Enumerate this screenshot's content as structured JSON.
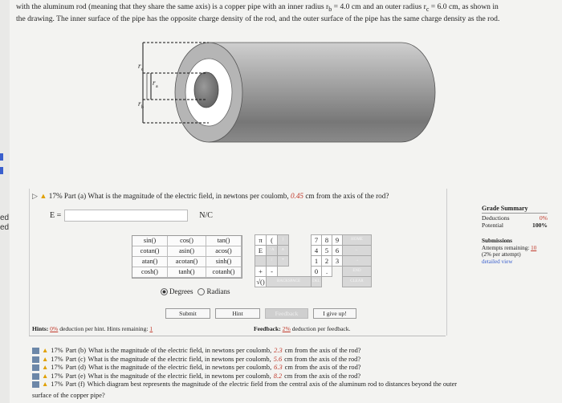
{
  "left_strip": {
    "marks": [
      "ed",
      "ed"
    ]
  },
  "intro": {
    "line1": "with the aluminum rod (meaning that they share the same axis) is a copper pipe with an inner radius r",
    "line1_sub": "b",
    "line1_b": " = 4.0 cm and an outer radius r",
    "line1_sub2": "c",
    "line1_c": " = 6.0 cm, as shown in",
    "line2": "the drawing. The inner surface of the pipe has the opposite charge density of the rod, and the outer surface of the pipe has the same charge density as the rod."
  },
  "figure": {
    "label_c": "r_c",
    "label_a": "r_a",
    "label_b": "r_b"
  },
  "part_a": {
    "percent": "17%",
    "label": "Part (a)",
    "question_pre": "What is the magnitude of the electric field, in newtons per coulomb,",
    "distance": "0.45",
    "question_post": "cm from the axis of the rod?",
    "answer_label": "E =",
    "answer_value": "",
    "unit": "N/C"
  },
  "keypad": {
    "functions": [
      "sin()",
      "cos()",
      "tan()",
      "cotan()",
      "asin()",
      "acos()",
      "atan()",
      "acotan()",
      "sinh()",
      "cosh()",
      "tanh()",
      "cotanh()"
    ],
    "degrees_label": "Degrees",
    "radians_label": "Radians",
    "row1": [
      "π",
      "(",
      ")",
      "7",
      "8",
      "9",
      "HOME"
    ],
    "row2": [
      "E",
      "↑A",
      "∧",
      "4",
      "5",
      "6",
      "←"
    ],
    "row3": [
      "",
      "/",
      "*",
      "1",
      "2",
      "3",
      "→"
    ],
    "row4": [
      "+",
      "-",
      "",
      "0",
      ".",
      "END"
    ],
    "row5": [
      "√()",
      "BACKSPACE",
      "DEL",
      "CLEAR"
    ]
  },
  "buttons": {
    "submit": "Submit",
    "hint": "Hint",
    "feedback": "Feedback",
    "give_up": "I give up!"
  },
  "hints": {
    "label": "Hints:",
    "pct": "0%",
    "text": "deduction per hint. Hints remaining:",
    "remaining": "1"
  },
  "feedback": {
    "label": "Feedback:",
    "pct": "2%",
    "text": "deduction per feedback."
  },
  "grade": {
    "title": "Grade Summary",
    "deductions_label": "Deductions",
    "deductions_value": "0%",
    "potential_label": "Potential",
    "potential_value": "100%"
  },
  "submissions": {
    "title": "Submissions",
    "attempts_label": "Attempts remaining:",
    "attempts_value": "10",
    "per_attempt": "(2% per attempt)",
    "detailed": "detailed view"
  },
  "parts": [
    {
      "percent": "17%",
      "label": "Part (b)",
      "pre": "What is the magnitude of the electric field, in newtons per coulomb,",
      "dist": "2.3",
      "post": "cm from the axis of the rod?"
    },
    {
      "percent": "17%",
      "label": "Part (c)",
      "pre": "What is the magnitude of the electric field, in newtons per coulomb,",
      "dist": "5.6",
      "post": "cm from the axis of the rod?"
    },
    {
      "percent": "17%",
      "label": "Part (d)",
      "pre": "What is the magnitude of the electric field, in newtons per coulomb,",
      "dist": "6.3",
      "post": "cm from the axis of the rod?"
    },
    {
      "percent": "17%",
      "label": "Part (e)",
      "pre": "What is the magnitude of the electric field, in newtons per coulomb,",
      "dist": "8.2",
      "post": "cm from the axis of the rod?"
    }
  ],
  "part_f": {
    "percent": "17%",
    "label": "Part (f)",
    "text": "Which diagram best represents the magnitude of the electric field from the central axis of the aluminum rod to distances beyond the outer",
    "text2": "surface of the copper pipe?"
  }
}
